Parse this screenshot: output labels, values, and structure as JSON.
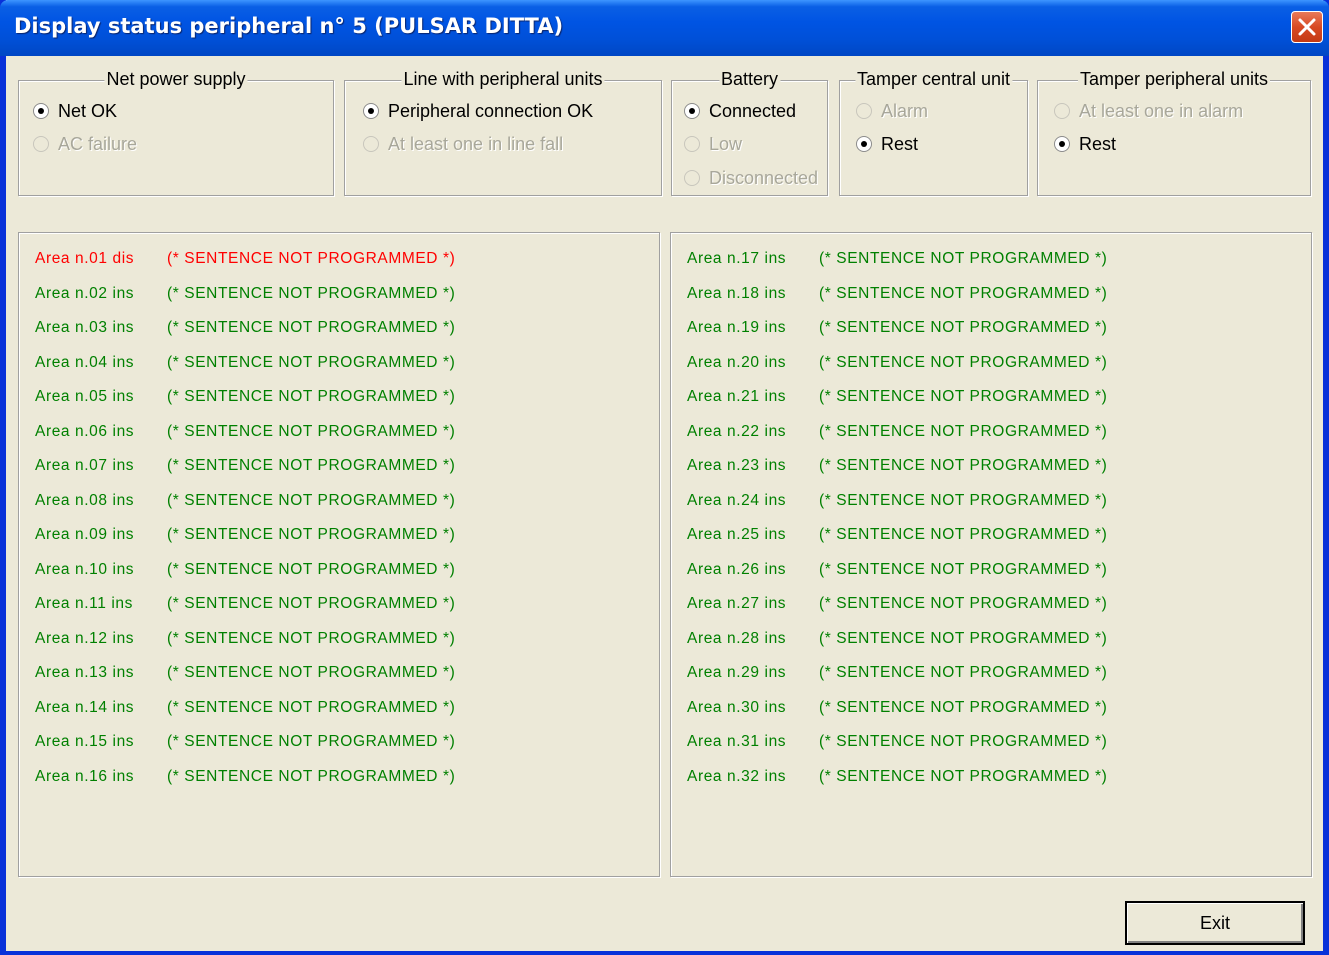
{
  "window": {
    "title": "Display status peripheral n° 5 (PULSAR DITTA)"
  },
  "colors": {
    "disabled_area": "#ff0000",
    "inserted_area": "#008000",
    "titlebar": "#0054e3"
  },
  "groups": {
    "net_power": {
      "label": "Net power supply",
      "options": [
        "Net OK",
        "AC failure"
      ],
      "selected": 0
    },
    "line": {
      "label": "Line with peripheral units",
      "options": [
        "Peripheral connection OK",
        "At least one in line fall"
      ],
      "selected": 0
    },
    "battery": {
      "label": "Battery",
      "options": [
        "Connected",
        "Low",
        "Disconnected"
      ],
      "selected": 0
    },
    "tamper_central": {
      "label": "Tamper central unit",
      "options": [
        "Alarm",
        "Rest"
      ],
      "selected": 1
    },
    "tamper_peripheral": {
      "label": "Tamper peripheral units",
      "options": [
        "At least one in alarm",
        "Rest"
      ],
      "selected": 1
    }
  },
  "areas_left": [
    {
      "label": "Area n.01 dis",
      "text": "(* SENTENCE NOT PROGRAMMED *)",
      "status": "dis"
    },
    {
      "label": "Area n.02 ins",
      "text": "(* SENTENCE NOT PROGRAMMED *)",
      "status": "ins"
    },
    {
      "label": "Area n.03 ins",
      "text": "(* SENTENCE NOT PROGRAMMED *)",
      "status": "ins"
    },
    {
      "label": "Area n.04 ins",
      "text": "(* SENTENCE NOT PROGRAMMED *)",
      "status": "ins"
    },
    {
      "label": "Area n.05 ins",
      "text": "(* SENTENCE NOT PROGRAMMED *)",
      "status": "ins"
    },
    {
      "label": "Area n.06 ins",
      "text": "(* SENTENCE NOT PROGRAMMED *)",
      "status": "ins"
    },
    {
      "label": "Area n.07 ins",
      "text": "(* SENTENCE NOT PROGRAMMED *)",
      "status": "ins"
    },
    {
      "label": "Area n.08 ins",
      "text": "(* SENTENCE NOT PROGRAMMED *)",
      "status": "ins"
    },
    {
      "label": "Area n.09 ins",
      "text": "(* SENTENCE NOT PROGRAMMED *)",
      "status": "ins"
    },
    {
      "label": "Area n.10 ins",
      "text": "(* SENTENCE NOT PROGRAMMED *)",
      "status": "ins"
    },
    {
      "label": "Area n.11 ins",
      "text": "(* SENTENCE NOT PROGRAMMED *)",
      "status": "ins"
    },
    {
      "label": "Area n.12 ins",
      "text": "(* SENTENCE NOT PROGRAMMED *)",
      "status": "ins"
    },
    {
      "label": "Area n.13 ins",
      "text": "(* SENTENCE NOT PROGRAMMED *)",
      "status": "ins"
    },
    {
      "label": "Area n.14 ins",
      "text": "(* SENTENCE NOT PROGRAMMED *)",
      "status": "ins"
    },
    {
      "label": "Area n.15 ins",
      "text": "(* SENTENCE NOT PROGRAMMED *)",
      "status": "ins"
    },
    {
      "label": "Area n.16 ins",
      "text": "(* SENTENCE NOT PROGRAMMED *)",
      "status": "ins"
    }
  ],
  "areas_right": [
    {
      "label": "Area n.17 ins",
      "text": "(* SENTENCE NOT PROGRAMMED *)",
      "status": "ins"
    },
    {
      "label": "Area n.18 ins",
      "text": "(* SENTENCE NOT PROGRAMMED *)",
      "status": "ins"
    },
    {
      "label": "Area n.19 ins",
      "text": "(* SENTENCE NOT PROGRAMMED *)",
      "status": "ins"
    },
    {
      "label": "Area n.20 ins",
      "text": "(* SENTENCE NOT PROGRAMMED *)",
      "status": "ins"
    },
    {
      "label": "Area n.21 ins",
      "text": "(* SENTENCE NOT PROGRAMMED *)",
      "status": "ins"
    },
    {
      "label": "Area n.22 ins",
      "text": "(* SENTENCE NOT PROGRAMMED *)",
      "status": "ins"
    },
    {
      "label": "Area n.23 ins",
      "text": "(* SENTENCE NOT PROGRAMMED *)",
      "status": "ins"
    },
    {
      "label": "Area n.24 ins",
      "text": "(* SENTENCE NOT PROGRAMMED *)",
      "status": "ins"
    },
    {
      "label": "Area n.25 ins",
      "text": "(* SENTENCE NOT PROGRAMMED *)",
      "status": "ins"
    },
    {
      "label": "Area n.26 ins",
      "text": "(* SENTENCE NOT PROGRAMMED *)",
      "status": "ins"
    },
    {
      "label": "Area n.27 ins",
      "text": "(* SENTENCE NOT PROGRAMMED *)",
      "status": "ins"
    },
    {
      "label": "Area n.28 ins",
      "text": "(* SENTENCE NOT PROGRAMMED *)",
      "status": "ins"
    },
    {
      "label": "Area n.29 ins",
      "text": "(* SENTENCE NOT PROGRAMMED *)",
      "status": "ins"
    },
    {
      "label": "Area n.30 ins",
      "text": "(* SENTENCE NOT PROGRAMMED *)",
      "status": "ins"
    },
    {
      "label": "Area n.31 ins",
      "text": "(* SENTENCE NOT PROGRAMMED *)",
      "status": "ins"
    },
    {
      "label": "Area n.32 ins",
      "text": "(* SENTENCE NOT PROGRAMMED *)",
      "status": "ins"
    }
  ],
  "buttons": {
    "exit": "Exit"
  }
}
